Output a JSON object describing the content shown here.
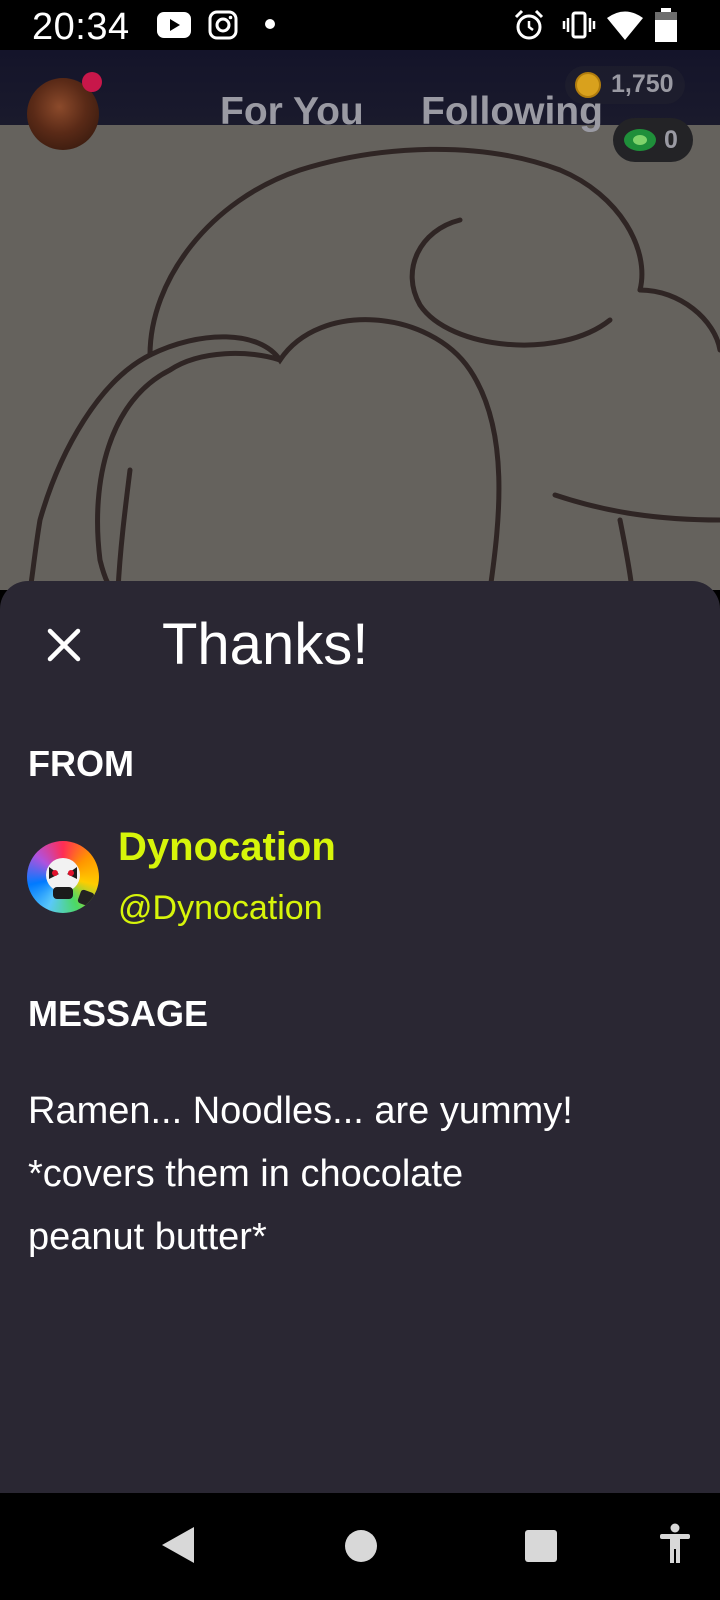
{
  "status_bar": {
    "time": "20:34",
    "left_icons": [
      "youtube-icon",
      "instagram-icon",
      "notification-dot-icon"
    ],
    "right_icons": [
      "alarm-icon",
      "vibrate-icon",
      "wifi-icon",
      "battery-icon"
    ]
  },
  "feed_header": {
    "tabs": [
      {
        "label": "For You"
      },
      {
        "label": "Following"
      }
    ],
    "coins": "1,750",
    "cash": "0"
  },
  "sheet": {
    "title": "Thanks!",
    "from_label": "FROM",
    "sender": {
      "name": "Dynocation",
      "handle": "@Dynocation"
    },
    "message_label": "MESSAGE",
    "message": "Ramen... Noodles... are yummy!\n*covers them in chocolate\npeanut butter*"
  },
  "colors": {
    "sheet_bg": "#2a2733",
    "accent": "#d7f50a",
    "live_dot": "#c8174a"
  },
  "nav_bar": {
    "buttons": [
      "back-icon",
      "home-icon",
      "recents-icon",
      "accessibility-icon"
    ]
  }
}
